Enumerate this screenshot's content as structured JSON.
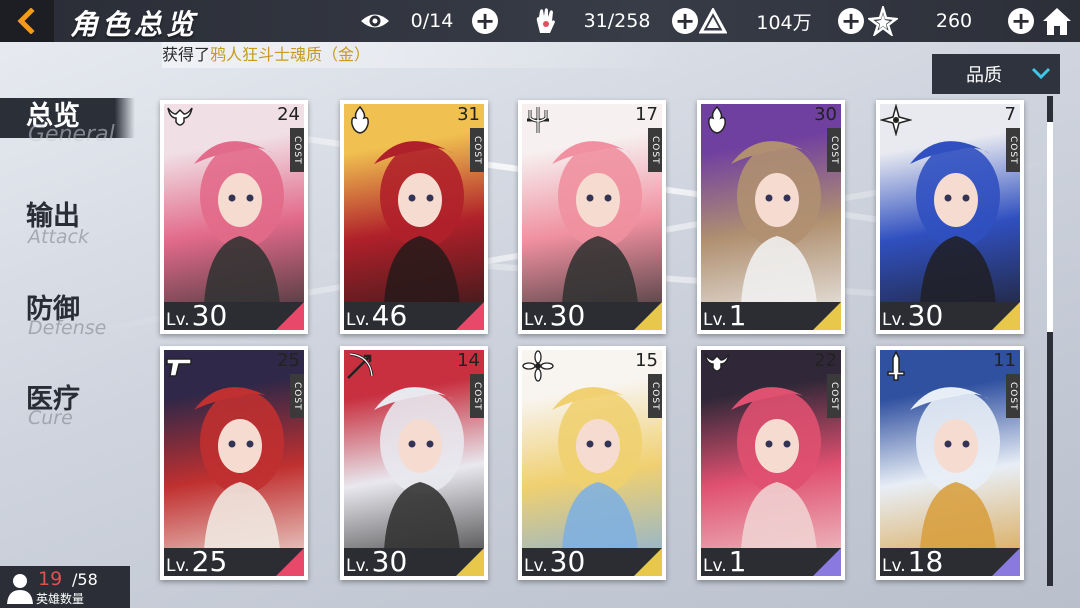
{
  "header": {
    "title": "角色总览",
    "resources": [
      {
        "icon": "eye-icon",
        "value": "0/14"
      },
      {
        "icon": "hand-icon",
        "value": "31/258"
      },
      {
        "icon": "pyramid-icon",
        "value": "104万"
      },
      {
        "icon": "star-icon",
        "value": "260"
      }
    ]
  },
  "ticker": {
    "prefix": "获得了",
    "highlight": "鸦人狂斗士魂质（金）"
  },
  "sort": {
    "label": "品质"
  },
  "tabs": [
    {
      "cn": "总览",
      "en": "General",
      "active": true
    },
    {
      "cn": "输出",
      "en": "Attack",
      "active": false
    },
    {
      "cn": "防御",
      "en": "Defense",
      "active": false
    },
    {
      "cn": "医疗",
      "en": "Cure",
      "active": false
    }
  ],
  "cards": [
    {
      "cost": "24",
      "level": "30",
      "rank_color": "#e8496a",
      "class_icon": "demon-horns-icon",
      "palette": [
        "#e26a8a",
        "#f0e0e6",
        "#333"
      ]
    },
    {
      "cost": "31",
      "level": "46",
      "rank_color": "#e8496a",
      "class_icon": "flame-icon",
      "palette": [
        "#b0202a",
        "#f0c050",
        "#2a1a1a"
      ]
    },
    {
      "cost": "17",
      "level": "30",
      "rank_color": "#e8c84a",
      "class_icon": "trident-icon",
      "palette": [
        "#f090a0",
        "#f6f0f0",
        "#333"
      ]
    },
    {
      "cost": "30",
      "level": "1",
      "rank_color": "#e8c84a",
      "class_icon": "flame-icon",
      "palette": [
        "#b09070",
        "#7040a0",
        "#f0f0f0"
      ]
    },
    {
      "cost": "7",
      "level": "30",
      "rank_color": "#e8c84a",
      "class_icon": "shuriken-icon",
      "palette": [
        "#3050c0",
        "#e8eaf0",
        "#202028"
      ]
    },
    {
      "cost": "25",
      "level": "25",
      "rank_color": "#e8496a",
      "class_icon": "pistol-icon",
      "palette": [
        "#c03030",
        "#302848",
        "#f0e8e0"
      ]
    },
    {
      "cost": "14",
      "level": "30",
      "rank_color": "#e8c84a",
      "class_icon": "bow-icon",
      "palette": [
        "#e8e8ee",
        "#c83040",
        "#333"
      ]
    },
    {
      "cost": "15",
      "level": "30",
      "rank_color": "#e8c84a",
      "class_icon": "flower-icon",
      "palette": [
        "#f0d070",
        "#f8f4f0",
        "#80b0e0"
      ]
    },
    {
      "cost": "22",
      "level": "1",
      "rank_color": "#8a7ae0",
      "class_icon": "demon-horns-icon",
      "palette": [
        "#e05070",
        "#302838",
        "#f0d0d0"
      ]
    },
    {
      "cost": "11",
      "level": "18",
      "rank_color": "#8a7ae0",
      "class_icon": "sword-icon",
      "palette": [
        "#e8eef6",
        "#3050a0",
        "#d8a040"
      ]
    }
  ],
  "hero_count": {
    "current": "19",
    "total": "/58",
    "label": "英雄数量"
  },
  "cost_label": "COST",
  "level_prefix": "Lv."
}
